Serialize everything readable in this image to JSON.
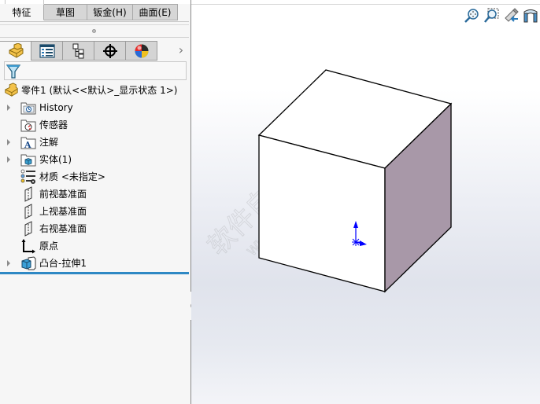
{
  "command_manager": {
    "tabs": [
      {
        "label": "特征",
        "active": true
      },
      {
        "label": "草图",
        "active": false
      },
      {
        "label": "钣金(H)",
        "active": false
      },
      {
        "label": "曲面(E)",
        "active": false
      }
    ]
  },
  "manager_tabs": [
    {
      "name": "featuremanager",
      "icon": "part-icon",
      "active": true
    },
    {
      "name": "propertymanager",
      "icon": "property-list-icon",
      "active": false
    },
    {
      "name": "configurationmanager",
      "icon": "configuration-tree-icon",
      "active": false
    },
    {
      "name": "dimxpertmanager",
      "icon": "crosshair-icon",
      "active": false
    },
    {
      "name": "displaymanager",
      "icon": "appearance-ball-icon",
      "active": false
    }
  ],
  "manager_more_label": "›",
  "filter": {
    "icon": "filter-icon"
  },
  "tree": {
    "root": {
      "label": "零件1  (默认<<默认>_显示状态 1>)",
      "icon": "part-icon"
    },
    "items": [
      {
        "label": "History",
        "icon": "history-folder-icon",
        "expandable": true
      },
      {
        "label": "传感器",
        "icon": "sensors-folder-icon",
        "expandable": false
      },
      {
        "label": "注解",
        "icon": "annotations-folder-icon",
        "expandable": true
      },
      {
        "label": "实体(1)",
        "icon": "solid-bodies-folder-icon",
        "expandable": true
      },
      {
        "label": "材质 <未指定>",
        "icon": "material-icon",
        "expandable": false
      },
      {
        "label": "前视基准面",
        "icon": "plane-icon",
        "expandable": false
      },
      {
        "label": "上视基准面",
        "icon": "plane-icon",
        "expandable": false
      },
      {
        "label": "右视基准面",
        "icon": "plane-icon",
        "expandable": false
      },
      {
        "label": "原点",
        "icon": "origin-icon",
        "expandable": false
      },
      {
        "label": "凸台-拉伸1",
        "icon": "boss-extrude-icon",
        "expandable": true
      }
    ]
  },
  "view_toolbar": [
    {
      "name": "zoom-to-fit",
      "icon": "zoom-to-fit-icon"
    },
    {
      "name": "zoom-to-area",
      "icon": "zoom-to-area-icon"
    },
    {
      "name": "previous-view",
      "icon": "previous-view-icon"
    },
    {
      "name": "section-view",
      "icon": "section-view-icon"
    }
  ],
  "model": {
    "type": "cube",
    "face_colors": {
      "top": "#ffffff",
      "front": "#ffffff",
      "right": "#a898a8"
    },
    "edge_color": "#000000",
    "triad_color": "#0000ff"
  },
  "watermark": {
    "text_cn": "软件自学网",
    "text_en": "WWW.RJZXW.COM"
  },
  "colors": {
    "selection_bar": "#2e88c4",
    "panel_bg": "#f6f6f6",
    "tab_bg": "#d6d6d6"
  }
}
